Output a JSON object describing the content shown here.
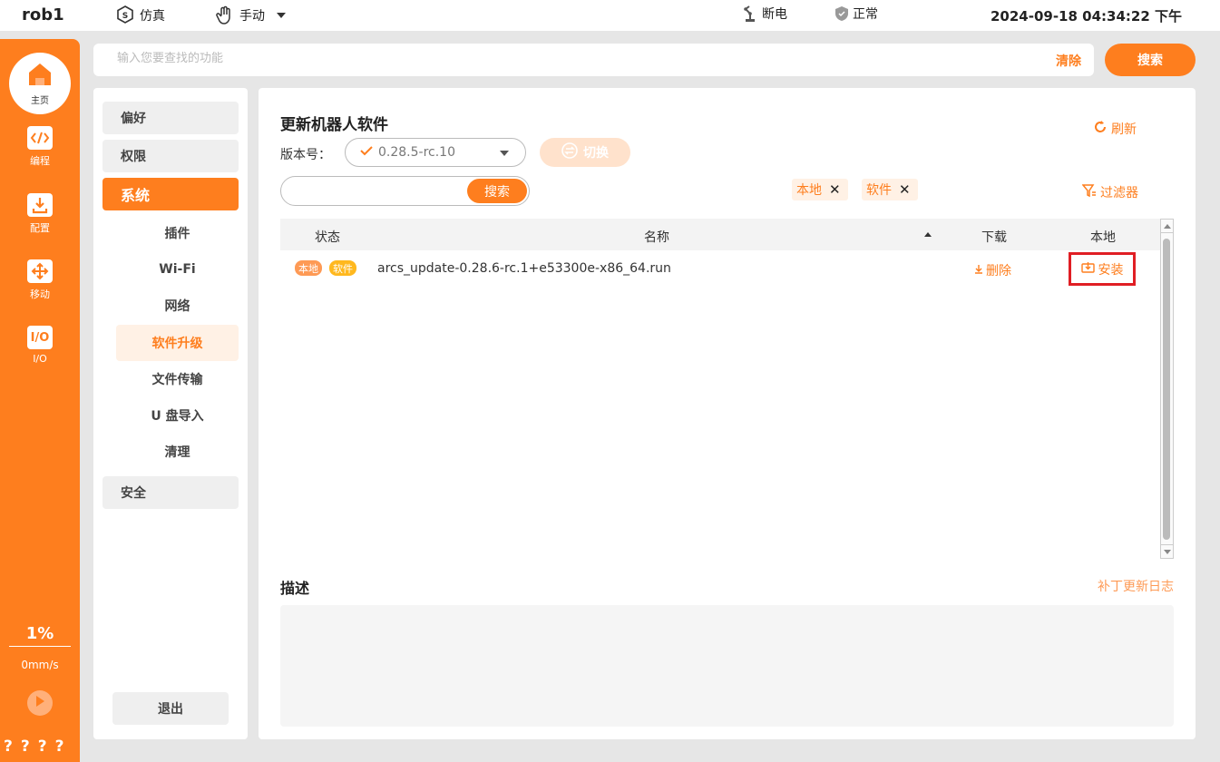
{
  "topbar": {
    "robot_name": "rob1",
    "mode_sim": "仿真",
    "mode_manual": "手动",
    "power_status": "断电",
    "safety_status": "正常",
    "datetime": "2024-09-18 04:34:22 下午"
  },
  "rail": {
    "home_label": "主页",
    "items": [
      {
        "label": "编程",
        "icon": "code-icon"
      },
      {
        "label": "配置",
        "icon": "download-config-icon"
      },
      {
        "label": "移动",
        "icon": "move-arrows-icon"
      },
      {
        "label": "I/O",
        "icon": "io-icon",
        "icon_text": "I/O"
      }
    ],
    "speed_percent": "1%",
    "speed_value": "0mm/s",
    "bottom_marks": [
      "?",
      "?",
      "?",
      "?"
    ]
  },
  "search": {
    "placeholder": "输入您要查找的功能",
    "clear_label": "清除",
    "button_label": "搜索"
  },
  "menu": {
    "sections": [
      "偏好",
      "权限",
      "系统",
      "安全"
    ],
    "sub_items": [
      "插件",
      "Wi-Fi",
      "网络",
      "软件升级",
      "文件传输",
      "U 盘导入",
      "清理"
    ],
    "active_section": "系统",
    "active_sub": "软件升级",
    "exit_label": "退出"
  },
  "main": {
    "title": "更新机器人软件",
    "refresh_label": "刷新",
    "version_label": "版本号：",
    "version_value": "0.28.5-rc.10",
    "switch_label": "切换",
    "list_search_label": "搜索",
    "chips": [
      "本地",
      "软件"
    ],
    "filter_label": "过滤器",
    "columns": {
      "status": "状态",
      "name": "名称",
      "download": "下载",
      "local": "本地"
    },
    "rows": [
      {
        "tags": [
          "本地",
          "软件"
        ],
        "filename": "arcs_update-0.28.6-rc.1+e53300e-x86_64.run",
        "download_action": "删除",
        "local_action": "安装"
      }
    ],
    "description_title": "描述",
    "changelog_link": "补丁更新日志"
  },
  "colors": {
    "accent": "#fe7e1e",
    "highlight_border": "#e01e24"
  }
}
